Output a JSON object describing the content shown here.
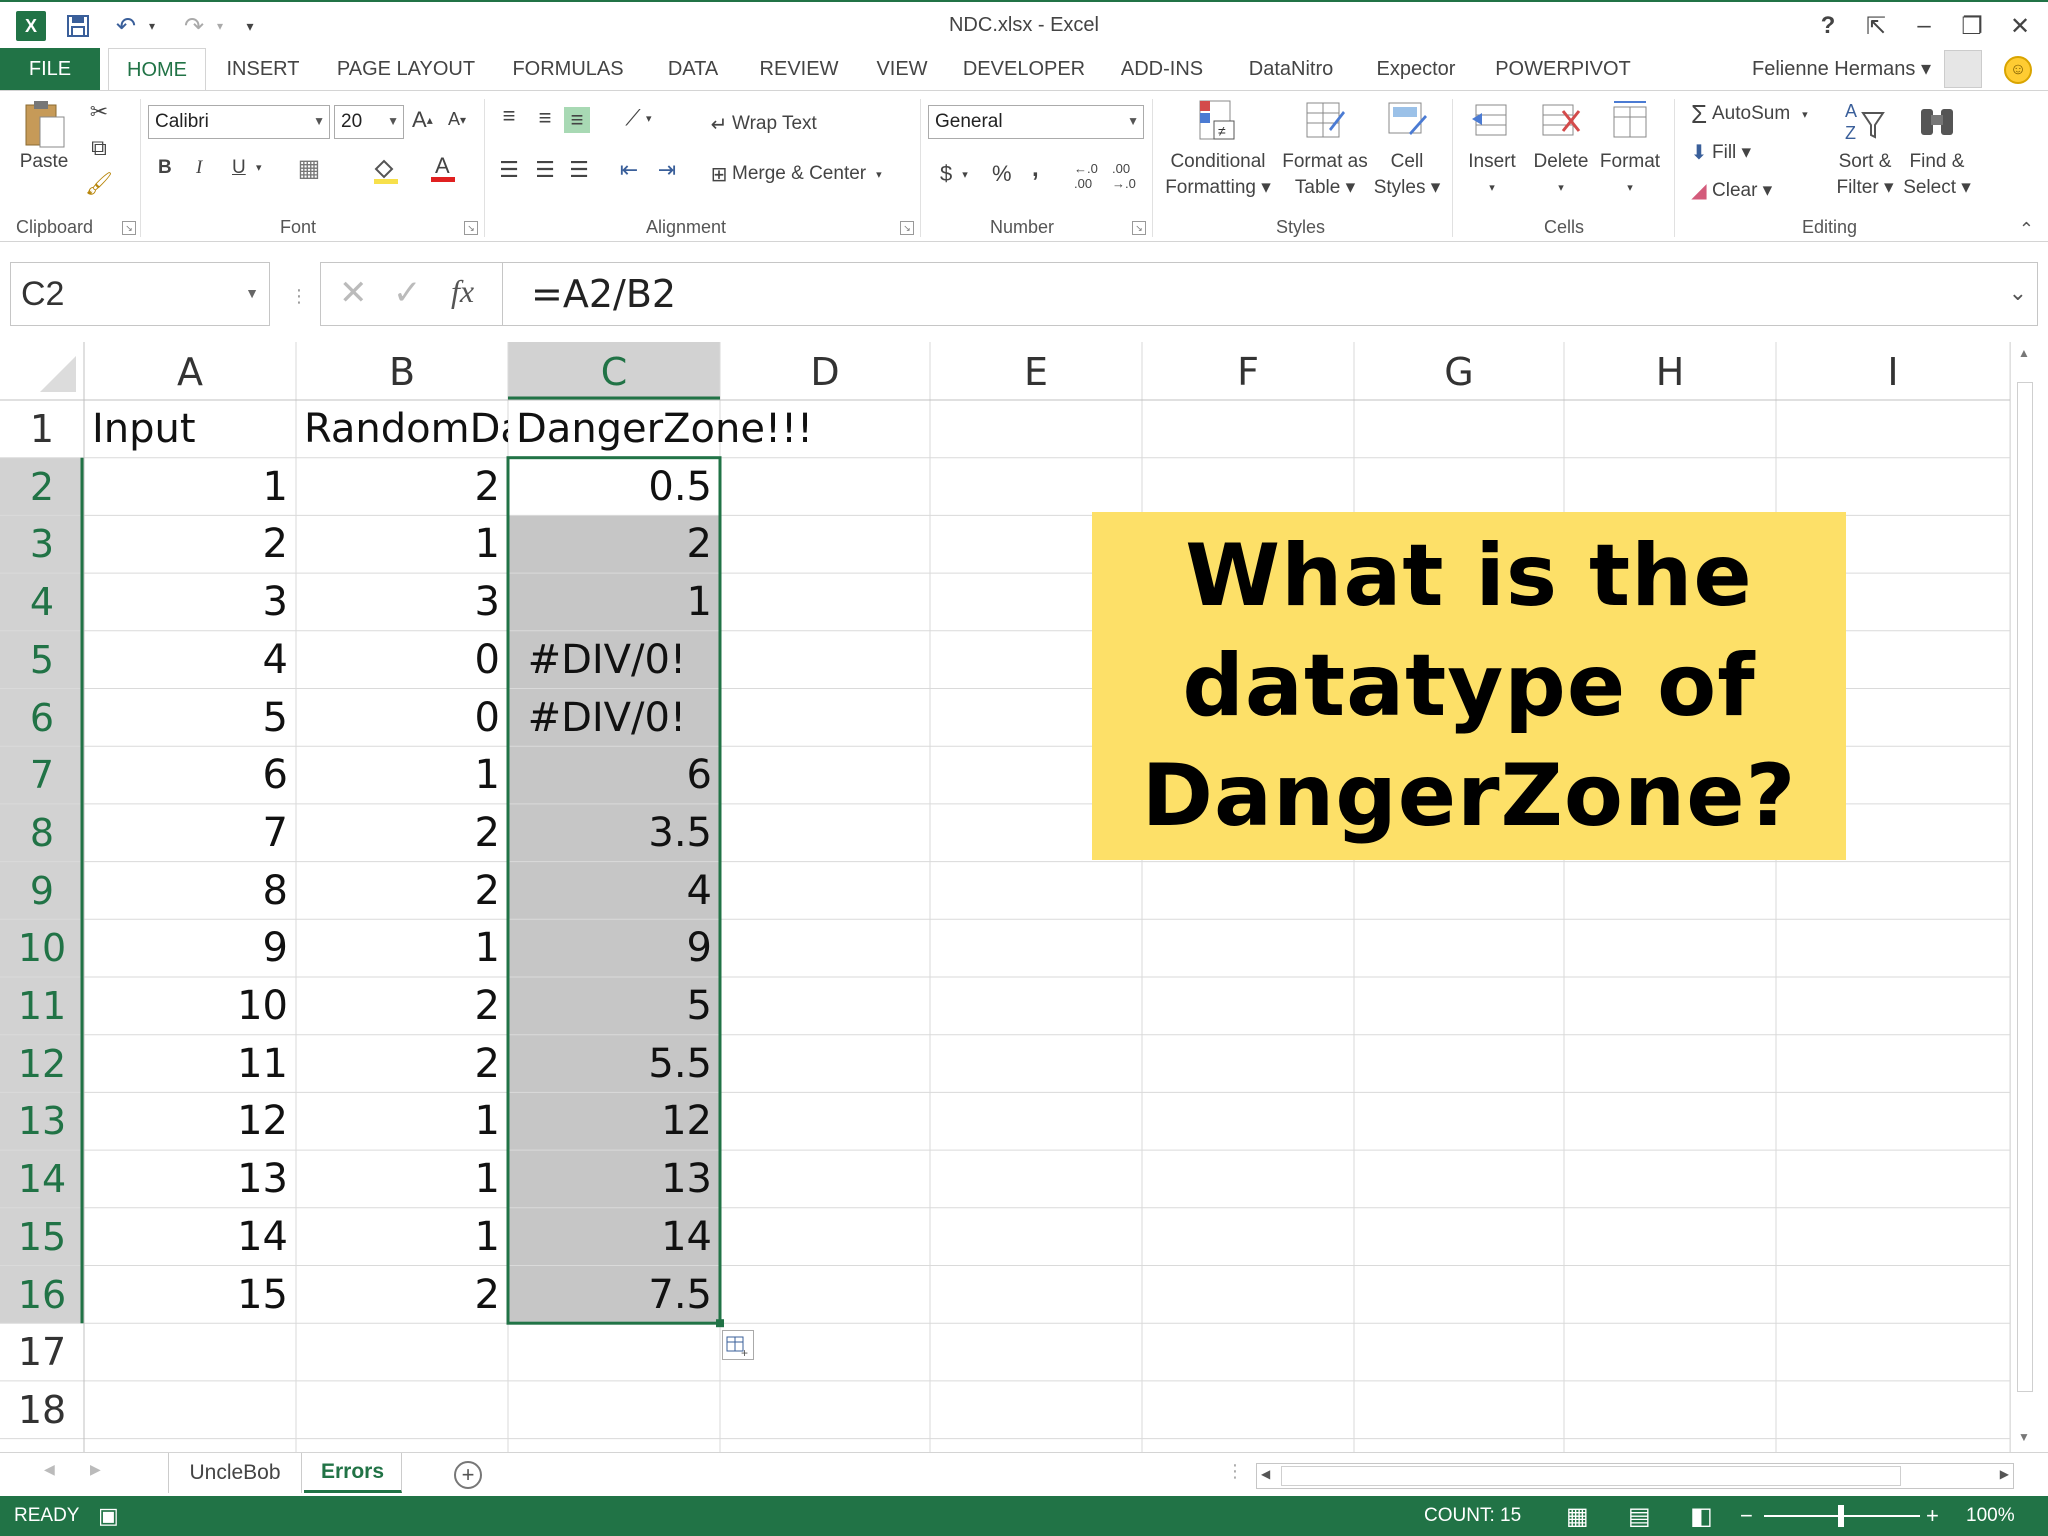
{
  "window": {
    "title": "NDC.xlsx - Excel",
    "logo": "X",
    "help": "?",
    "minimize": "–",
    "restore": "❐",
    "close": "✕"
  },
  "quick_access": {
    "undo": "↶",
    "redo": "↷",
    "customize": "▾"
  },
  "ribbon_tabs": {
    "file": "FILE",
    "items": [
      "HOME",
      "INSERT",
      "PAGE LAYOUT",
      "FORMULAS",
      "DATA",
      "REVIEW",
      "VIEW",
      "DEVELOPER",
      "ADD-INS",
      "DataNitro",
      "Expector",
      "POWERPIVOT"
    ],
    "active": "HOME",
    "user": "Felienne Hermans ▾"
  },
  "ribbon": {
    "clipboard": {
      "label": "Clipboard",
      "paste": "Paste"
    },
    "font": {
      "label": "Font",
      "name": "Calibri",
      "size": "20",
      "bold": "B",
      "italic": "I",
      "underline": "U"
    },
    "alignment": {
      "label": "Alignment",
      "wrap_text": "Wrap Text",
      "merge_center": "Merge & Center"
    },
    "number": {
      "label": "Number",
      "format": "General",
      "currency": "$",
      "percent": "%",
      "comma": ","
    },
    "styles": {
      "label": "Styles",
      "conditional_1": "Conditional",
      "conditional_2": "Formatting ▾",
      "format_as_1": "Format as",
      "format_as_2": "Table ▾",
      "cell_styles_1": "Cell",
      "cell_styles_2": "Styles ▾"
    },
    "cells": {
      "label": "Cells",
      "insert": "Insert",
      "delete": "Delete",
      "format": "Format"
    },
    "editing": {
      "label": "Editing",
      "autosum": "AutoSum",
      "fill": "Fill ▾",
      "clear": "Clear ▾",
      "sort_1": "Sort &",
      "sort_2": "Filter ▾",
      "find_1": "Find &",
      "find_2": "Select ▾"
    }
  },
  "formula_bar": {
    "name_box": "C2",
    "fx": "fx",
    "formula": "=A2/B2"
  },
  "sheet": {
    "columns": [
      "A",
      "B",
      "C",
      "D",
      "E",
      "F",
      "G",
      "H",
      "I"
    ],
    "selected_column": "C",
    "rows": [
      {
        "n": "1",
        "a": "Input",
        "b": "RandomDa",
        "c": "DangerZone!!!"
      },
      {
        "n": "2",
        "a": "1",
        "b": "2",
        "c": "0.5"
      },
      {
        "n": "3",
        "a": "2",
        "b": "1",
        "c": "2"
      },
      {
        "n": "4",
        "a": "3",
        "b": "3",
        "c": "1"
      },
      {
        "n": "5",
        "a": "4",
        "b": "0",
        "c": "#DIV/0!"
      },
      {
        "n": "6",
        "a": "5",
        "b": "0",
        "c": "#DIV/0!"
      },
      {
        "n": "7",
        "a": "6",
        "b": "1",
        "c": "6"
      },
      {
        "n": "8",
        "a": "7",
        "b": "2",
        "c": "3.5"
      },
      {
        "n": "9",
        "a": "8",
        "b": "2",
        "c": "4"
      },
      {
        "n": "10",
        "a": "9",
        "b": "1",
        "c": "9"
      },
      {
        "n": "11",
        "a": "10",
        "b": "2",
        "c": "5"
      },
      {
        "n": "12",
        "a": "11",
        "b": "2",
        "c": "5.5"
      },
      {
        "n": "13",
        "a": "12",
        "b": "1",
        "c": "12"
      },
      {
        "n": "14",
        "a": "13",
        "b": "1",
        "c": "13"
      },
      {
        "n": "15",
        "a": "14",
        "b": "1",
        "c": "14"
      },
      {
        "n": "16",
        "a": "15",
        "b": "2",
        "c": "7.5"
      },
      {
        "n": "17",
        "a": "",
        "b": "",
        "c": ""
      },
      {
        "n": "18",
        "a": "",
        "b": "",
        "c": ""
      }
    ],
    "callout": [
      "What is the",
      "datatype of",
      "DangerZone?"
    ]
  },
  "sheet_tabs": {
    "items": [
      "UncleBob",
      "Errors"
    ],
    "active": "Errors",
    "add": "+"
  },
  "status_bar": {
    "mode": "READY",
    "count": "COUNT: 15",
    "zoom": "100%"
  },
  "colors": {
    "accent": "#217346",
    "selection_fill": "#c6c6c6",
    "callout_fill": "#fde068",
    "header_selected": "#d2d2d2"
  }
}
